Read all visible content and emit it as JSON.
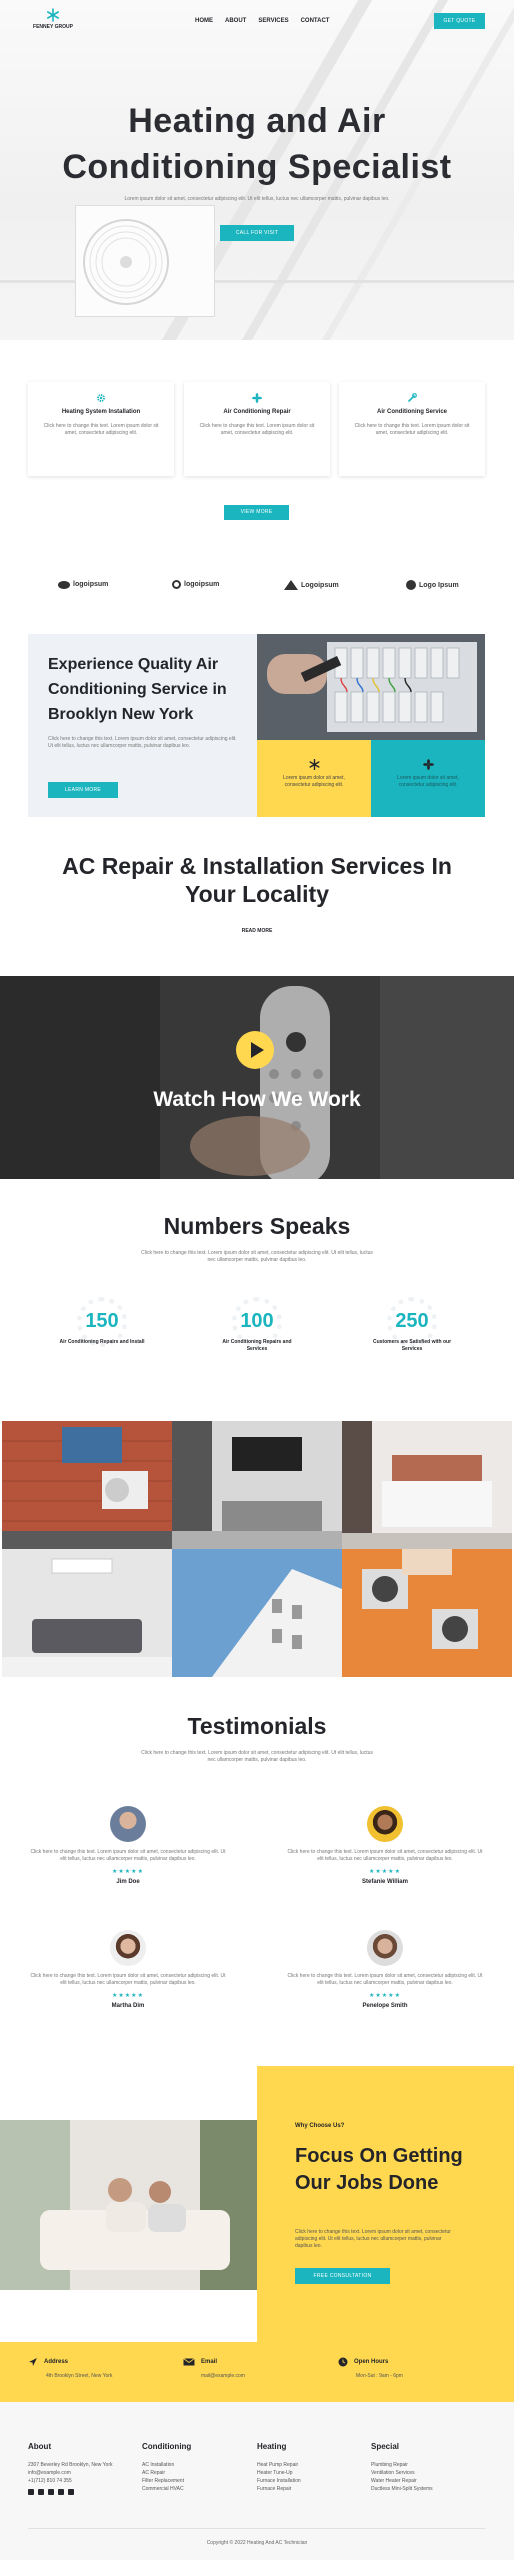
{
  "header": {
    "logo_text": "FENNEY GROUP",
    "nav": [
      "HOME",
      "ABOUT",
      "SERVICES",
      "CONTACT"
    ],
    "quote_button": "GET QUOTE"
  },
  "hero": {
    "title": "Heating and Air Conditioning Specialist",
    "subtitle": "Lorem ipsum dolor sit amet, consectetur adipiscing elit. Ut elit tellus, luctus nec ullamcorper mattis, pulvinar dapibus leo.",
    "button": "CALL FOR VISIT"
  },
  "services": {
    "items": [
      {
        "title": "Heating System Installation",
        "icon": "gear-icon",
        "desc": "Click here to change this text. Lorem ipsum dolor sit amet, consectetur adipiscing elit."
      },
      {
        "title": "Air Conditioning Repair",
        "icon": "fan-icon",
        "desc": "Click here to change this text. Lorem ipsum dolor sit amet, consectetur adipiscing elit."
      },
      {
        "title": "Air Conditioning Service",
        "icon": "wrench-icon",
        "desc": "Click here to change this text. Lorem ipsum dolor sit amet, consectetur adipiscing elit."
      }
    ],
    "view_more": "VIEW MORE"
  },
  "logos": [
    "logoipsum",
    "logoipsum",
    "Logoipsum",
    "Logo Ipsum"
  ],
  "quality": {
    "title": "Experience Quality Air Conditioning Service in Brooklyn New York",
    "text": "Click here to change this text. Lorem ipsum dolor sit amet, consectetur adipiscing elit. Ut elit tellus, luctus nec ullamcorper mattis, pulvinar dapibus leo.",
    "button": "LEARN MORE",
    "box1_text": "Lorem ipsum dolor sit amet, consectetur adipiscing elit.",
    "box2_text": "Lorem ipsum dolor sit amet, consectetur adipiscing elit."
  },
  "ac_repair": {
    "title": "AC Repair & Installation Services In Your Locality",
    "read_more": "READ MORE"
  },
  "video": {
    "title": "Watch How We Work"
  },
  "numbers": {
    "title": "Numbers Speaks",
    "subtitle": "Click here to change this text. Lorem ipsum dolor sit amet, consectetur adipiscing elit. Ut elit tellus, luctus nec ullamcorper mattis, pulvinar dapibus leo.",
    "stats": [
      {
        "value": "150",
        "label": "Air Conditioning Repairs and Install"
      },
      {
        "value": "100",
        "label": "Air Conditioning Repairs and Services"
      },
      {
        "value": "250",
        "label": "Customers are Satisfied with our Services"
      }
    ]
  },
  "testimonials": {
    "title": "Testimonials",
    "subtitle": "Click here to change this text. Lorem ipsum dolor sit amet, consectetur adipiscing elit. Ut elit tellus, luctus nec ullamcorper mattis, pulvinar dapibus leo.",
    "items": [
      {
        "name": "Jim Doe",
        "quote": "Click here to change this text. Lorem ipsum dolor sit amet, consectetur adipiscing elit. Ut elit tellus, luctus nec ullamcorper mattis, pulvinar dapibus leo.",
        "stars": "★★★★★"
      },
      {
        "name": "Stefanie William",
        "quote": "Click here to change this text. Lorem ipsum dolor sit amet, consectetur adipiscing elit. Ut elit tellus, luctus nec ullamcorper mattis, pulvinar dapibus leo.",
        "stars": "★★★★★"
      },
      {
        "name": "Martha Dim",
        "quote": "Click here to change this text. Lorem ipsum dolor sit amet, consectetur adipiscing elit. Ut elit tellus, luctus nec ullamcorper mattis, pulvinar dapibus leo.",
        "stars": "★★★★★"
      },
      {
        "name": "Penelope Smith",
        "quote": "Click here to change this text. Lorem ipsum dolor sit amet, consectetur adipiscing elit. Ut elit tellus, luctus nec ullamcorper mattis, pulvinar dapibus leo.",
        "stars": "★★★★★"
      }
    ]
  },
  "focus": {
    "why": "Why Choose Us?",
    "title": "Focus On Getting Our Jobs Done",
    "text": "Click here to change this text. Lorem ipsum dolor sit amet, consectetur adipiscing elit. Ut elit tellus, luctus nec ullamcorper mattis, pulvinar dapibus leo.",
    "button": "FREE CONSULTATION"
  },
  "contact": [
    {
      "label": "Address",
      "value": "4th Brooklyn Street, New York",
      "icon": "location-arrow-icon"
    },
    {
      "label": "Email",
      "value": "mail@example.com",
      "icon": "envelope-icon"
    },
    {
      "label": "Open Hours",
      "value": "Mon-Sat : 9am - 6pm",
      "icon": "clock-icon"
    }
  ],
  "footer": {
    "columns": [
      {
        "heading": "About",
        "items": [
          "2307 Beverley Rd Brooklyn, New York info@example.com",
          "+1(712) 810 74 355"
        ]
      },
      {
        "heading": "Conditioning",
        "items": [
          "AC Installation",
          "AC Repair",
          "Filter Replacement",
          "Commercial HVAC"
        ]
      },
      {
        "heading": "Heating",
        "items": [
          "Heat Pump Repair",
          "Heater Tune-Up",
          "Furnace Installation",
          "Furnace Repair"
        ]
      },
      {
        "heading": "Special",
        "items": [
          "Plumbing Repair",
          "Ventilation Services",
          "Water Heater Repair",
          "Ductless Mini-Split Systems"
        ]
      }
    ],
    "copyright": "Copyright © 2022 Heating And AC Technician"
  },
  "colors": {
    "accent": "#1bb5bf",
    "yellow": "#ffd84f",
    "dark": "#24252a"
  }
}
